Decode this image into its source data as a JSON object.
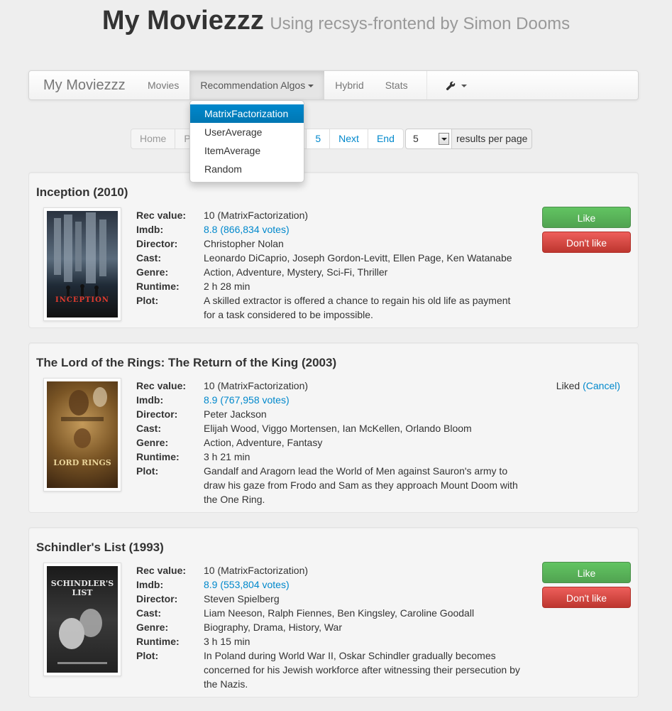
{
  "header": {
    "title": "My Moviezzz",
    "subtitle": "Using recsys-frontend by Simon Dooms"
  },
  "navbar": {
    "brand": "My Moviezzz",
    "items": [
      {
        "label": "Movies"
      },
      {
        "label": "Recommendation Algos"
      },
      {
        "label": "Hybrid"
      },
      {
        "label": "Stats"
      }
    ],
    "settings_icon": "wrench-icon"
  },
  "dropdown": {
    "options": [
      "MatrixFactorization",
      "UserAverage",
      "ItemAverage",
      "Random"
    ],
    "selected": "MatrixFactorization"
  },
  "pagination": {
    "home": "Home",
    "prev_partial": "P",
    "page": "5",
    "next": "Next",
    "end": "End"
  },
  "per_page": {
    "value": "5",
    "label": "results per page"
  },
  "labels": {
    "rec_value": "Rec value:",
    "imdb": "Imdb:",
    "director": "Director:",
    "cast": "Cast:",
    "genre": "Genre:",
    "runtime": "Runtime:",
    "plot": "Plot:"
  },
  "movies": [
    {
      "title": "Inception (2010)",
      "rec_value": "10 (MatrixFactorization)",
      "imdb": "8.8 (866,834 votes)",
      "director": "Christopher Nolan",
      "cast": "Leonardo DiCaprio, Joseph Gordon-Levitt, Ellen Page, Ken Watanabe",
      "genre": "Action, Adventure, Mystery, Sci-Fi, Thriller",
      "runtime": "2 h 28 min",
      "plot": "A skilled extractor is offered a chance to regain his old life as payment for a task considered to be impossible.",
      "poster_text": "INCEPTION",
      "like_label": "Like",
      "dislike_label": "Don't like"
    },
    {
      "title": "The Lord of the Rings: The Return of the King (2003)",
      "rec_value": "10 (MatrixFactorization)",
      "imdb": "8.9 (767,958 votes)",
      "director": "Peter Jackson",
      "cast": "Elijah Wood, Viggo Mortensen, Ian McKellen, Orlando Bloom",
      "genre": "Action, Adventure, Fantasy",
      "runtime": "3 h 21 min",
      "plot": "Gandalf and Aragorn lead the World of Men against Sauron's army to draw his gaze from Frodo and Sam as they approach Mount Doom with the One Ring.",
      "poster_text": "LORD RINGS",
      "status": "Liked",
      "cancel_label": "(Cancel)"
    },
    {
      "title": "Schindler's List (1993)",
      "rec_value": "10 (MatrixFactorization)",
      "imdb": "8.9 (553,804 votes)",
      "director": "Steven Spielberg",
      "cast": "Liam Neeson, Ralph Fiennes, Ben Kingsley, Caroline Goodall",
      "genre": "Biography, Drama, History, War",
      "runtime": "3 h 15 min",
      "plot": "In Poland during World War II, Oskar Schindler gradually becomes concerned for his Jewish workforce after witnessing their persecution by the Nazis.",
      "poster_text": "SCHINDLER'S LIST",
      "like_label": "Like",
      "dislike_label": "Don't like"
    }
  ],
  "colors": {
    "link": "#0088cc",
    "like": "#5bb75b",
    "dislike": "#da4f49",
    "active_option": "#0081c2"
  }
}
